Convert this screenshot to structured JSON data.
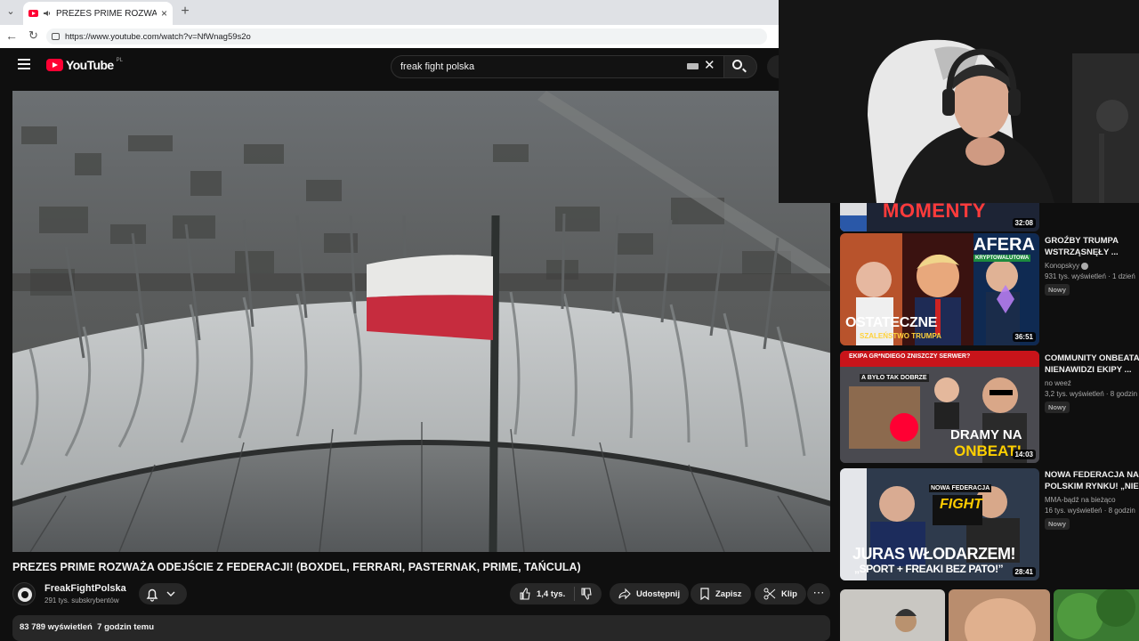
{
  "browser": {
    "tab_title": "PREZES PRIME ROZWAŻA ODE",
    "tab_close": "×",
    "new_tab": "+",
    "tab_list": "⌄",
    "back": "←",
    "reload": "↻",
    "url": "https://www.youtube.com/watch?v=NfWnag59s2o"
  },
  "youtube": {
    "logo_text": "YouTube",
    "logo_country": "PL",
    "search_value": "freak fight polska",
    "clear": "✕"
  },
  "video": {
    "title": "PREZES PRIME ROZWAŻA ODEJŚCIE Z FEDERACJI! (BOXDEL, FERRARI, PASTERNAK, PRIME, TAŃCULA)",
    "channel_name": "FreakFightPolska",
    "subscribers": "291 tys. subskrybentów",
    "likes": "1,4 tys.",
    "share_label": "Udostępnij",
    "save_label": "Zapisz",
    "clip_label": "Klip",
    "more": "⋯",
    "views": "83 789 wyświetleń",
    "time_ago": "7 godzin temu"
  },
  "sidebar": {
    "top_partial": {
      "overlay_text": "MOMENTY",
      "duration": "32:08"
    },
    "items": [
      {
        "title_line1": "GROŹBY TRUMPA",
        "title_line2": "WSTRZĄSNĘŁY ...",
        "channel": "Konopskyy",
        "meta": "931 tys. wyświetleń · 1 dzień",
        "badge": "Nowy",
        "duration": "36:51",
        "thumb_top": "AFERA",
        "thumb_sub": "KRYPTOWALUTOWA",
        "thumb_bottom": "OSTATECZNE",
        "thumb_bottom2": "SZALEŃSTWO TRUMPA"
      },
      {
        "title_line1": "COMMUNITY ONBEATA",
        "title_line2": "NIENAWIDZI EKIPY ...",
        "channel": "no weeź",
        "meta": "3,2 tys. wyświetleń · 8 godzin",
        "badge": "Nowy",
        "duration": "14:03",
        "thumb_top": "EKIPA GR*NDIEGO ZNISZCZY SERWER?",
        "thumb_mid": "A BYŁO TAK DOBRZE",
        "thumb_bottom": "DRAMY NA",
        "thumb_bottom2": "ONBEAT!"
      },
      {
        "title_line1": "NOWA FEDERACJA NA",
        "title_line2": "POLSKIM RYNKU! „NIE ...",
        "channel": "MMA-bądź na bieżąco",
        "meta": "16 tys. wyświetleń · 8 godzin",
        "badge": "Nowy",
        "duration": "28:41",
        "thumb_top": "NOWA FEDERACJA",
        "thumb_mid": "FIGHT",
        "thumb_bottom": "JURAS WŁODARZEM!",
        "thumb_bottom2": "„SPORT + FREAKI BEZ PATO!”"
      }
    ]
  },
  "colors": {
    "yt_red": "#ff0033",
    "bg": "#0f0f0f",
    "pill": "#272727"
  }
}
